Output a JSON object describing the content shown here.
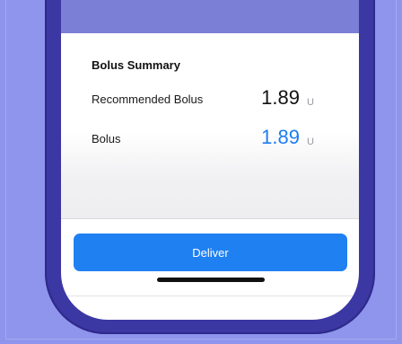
{
  "bolus_summary": {
    "title": "Bolus Summary",
    "recommended": {
      "label": "Recommended Bolus",
      "value": "1.89",
      "unit": "U"
    },
    "bolus": {
      "label": "Bolus",
      "value": "1.89",
      "unit": "U"
    }
  },
  "actions": {
    "deliver_label": "Deliver"
  },
  "colors": {
    "accent": "#1f80f2",
    "bolus_value": "#1d7cf2",
    "background": "#8f94ec",
    "phone_frame": "#3b37a3"
  }
}
